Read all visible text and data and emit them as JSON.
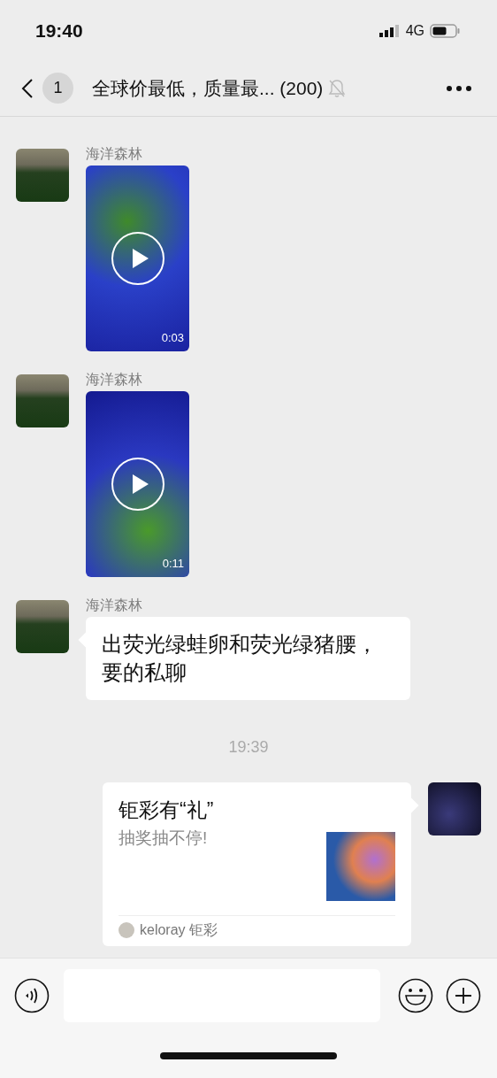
{
  "status_bar": {
    "time": "19:40",
    "network": "4G"
  },
  "header": {
    "unread_badge": "1",
    "title": "全球价最低，质量最... (200)",
    "muted": true
  },
  "messages": [
    {
      "kind": "video",
      "sender": "海洋森林",
      "duration": "0:03"
    },
    {
      "kind": "video",
      "sender": "海洋森林",
      "duration": "0:11"
    },
    {
      "kind": "text",
      "sender": "海洋森林",
      "text": "出荧光绿蛙卵和荧光绿猪腰，要的私聊"
    },
    {
      "kind": "time",
      "text": "19:39"
    },
    {
      "kind": "card",
      "title": "钜彩有“礼”",
      "description": "抽奖抽不停!",
      "source": "keloray 钜彩"
    }
  ]
}
